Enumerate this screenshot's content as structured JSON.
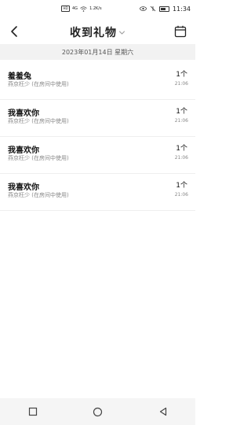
{
  "status_bar": {
    "left_badge": "HD",
    "network_label": "4G",
    "speed_text": "1.2K/s",
    "time": "11:34"
  },
  "header": {
    "title": "收到礼物",
    "back_icon": "chevron-left-icon",
    "dropdown_icon": "chevron-down-icon",
    "calendar_icon": "calendar-icon"
  },
  "date_bar": {
    "text": "2023年01月14日 星期六"
  },
  "gifts": [
    {
      "name": "羞羞兔",
      "from": "燕京枉少 (在房间中使用)",
      "count": "1个",
      "time": "21:06"
    },
    {
      "name": "我喜欢你",
      "from": "燕京枉少 (在房间中使用)",
      "count": "1个",
      "time": "21:06"
    },
    {
      "name": "我喜欢你",
      "from": "燕京枉少 (在房间中使用)",
      "count": "1个",
      "time": "21:06"
    },
    {
      "name": "我喜欢你",
      "from": "燕京枉少 (在房间中使用)",
      "count": "1个",
      "time": "21:06"
    }
  ],
  "nav_bar": {
    "icons": [
      "square-icon",
      "circle-icon",
      "triangle-back-icon"
    ]
  }
}
